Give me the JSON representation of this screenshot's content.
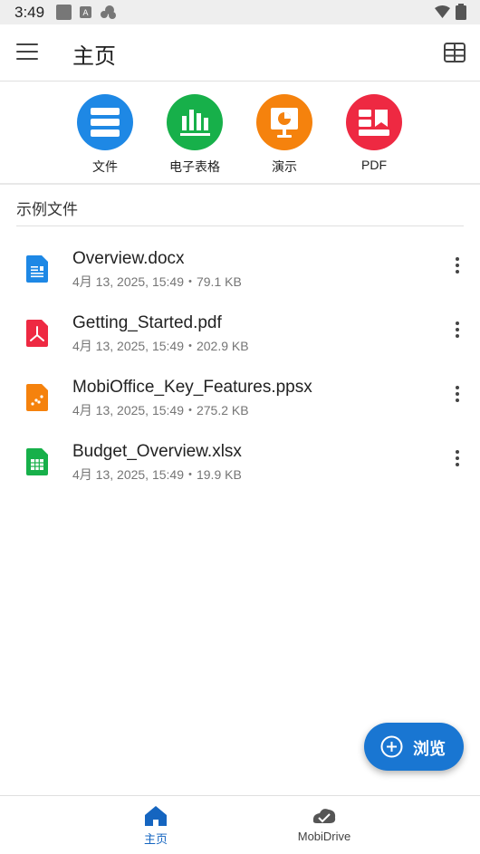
{
  "status_bar": {
    "time": "3:49"
  },
  "app_bar": {
    "title": "主页"
  },
  "quick_actions": [
    {
      "label": "文件",
      "color": "#1e88e5",
      "icon": "document-stack-icon"
    },
    {
      "label": "电子表格",
      "color": "#17b04a",
      "icon": "bar-chart-icon"
    },
    {
      "label": "演示",
      "color": "#f5820d",
      "icon": "presentation-icon"
    },
    {
      "label": "PDF",
      "color": "#ee2942",
      "icon": "pdf-icon"
    }
  ],
  "section": {
    "title": "示例文件"
  },
  "files": [
    {
      "name": "Overview.docx",
      "meta": "4月 13, 2025, 15:49・79.1 KB",
      "icon": "word-doc-icon",
      "color": "#1e88e5"
    },
    {
      "name": "Getting_Started.pdf",
      "meta": "4月 13, 2025, 15:49・202.9 KB",
      "icon": "pdf-file-icon",
      "color": "#ee2942"
    },
    {
      "name": "MobiOffice_Key_Features.ppsx",
      "meta": "4月 13, 2025, 15:49・275.2 KB",
      "icon": "slides-file-icon",
      "color": "#f5820d"
    },
    {
      "name": "Budget_Overview.xlsx",
      "meta": "4月 13, 2025, 15:49・19.9 KB",
      "icon": "sheet-file-icon",
      "color": "#17b04a"
    }
  ],
  "fab": {
    "label": "浏览"
  },
  "bottom_nav": [
    {
      "label": "主页",
      "active": true,
      "color": "#1565c0"
    },
    {
      "label": "MobiDrive",
      "active": false,
      "color": "#424242"
    }
  ]
}
